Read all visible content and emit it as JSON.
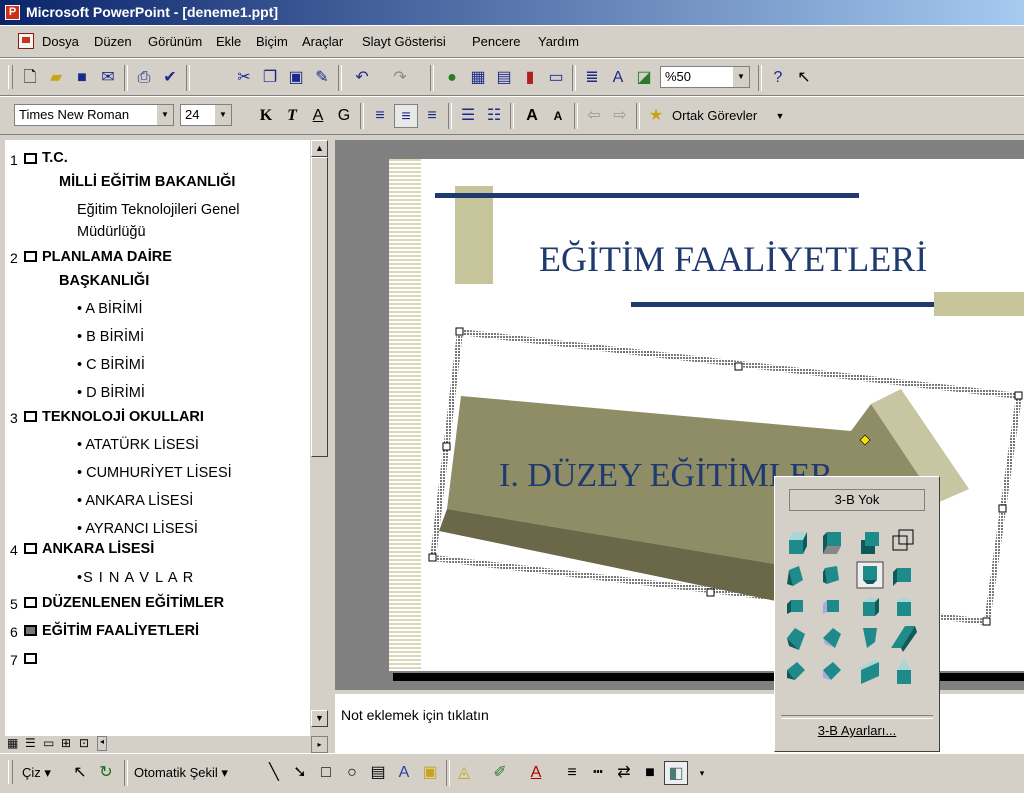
{
  "window": {
    "title": "Microsoft PowerPoint - [deneme1.ppt]"
  },
  "menu": [
    {
      "label": "Dosya"
    },
    {
      "label": "Düzen"
    },
    {
      "label": "Görünüm"
    },
    {
      "label": "Ekle"
    },
    {
      "label": "Biçim"
    },
    {
      "label": "Araçlar"
    },
    {
      "label": "Slayt Gösterisi"
    },
    {
      "label": "Pencere"
    },
    {
      "label": "Yardım"
    }
  ],
  "toolbar": {
    "zoom": "%50"
  },
  "format": {
    "font": "Times New Roman",
    "size": "24",
    "tasks": "Ortak Görevler"
  },
  "outline": {
    "slides": [
      {
        "num": "1",
        "title": "T.C.",
        "title2": "MİLLİ EĞİTİM BAKANLIĞI",
        "sub": "Eğitim Teknolojileri Genel",
        "sub2": "Müdürlüğü",
        "icon": "slide-outline-icon"
      },
      {
        "num": "2",
        "title": "PLANLAMA DAİRE",
        "title2": "BAŞKANLIĞI",
        "bullets": [
          "A BİRİMİ",
          "B BİRİMİ",
          "C BİRİMİ",
          "D BİRİMİ"
        ],
        "icon": "slide-outline-icon"
      },
      {
        "num": "3",
        "title": "TEKNOLOJİ OKULLARI",
        "bullets": [
          "ATATÜRK LİSESİ",
          "CUMHURİYET LİSESİ",
          "ANKARA LİSESİ",
          "AYRANCI LİSESİ"
        ],
        "icon": "slide-outline-icon"
      },
      {
        "num": "4",
        "title": "ANKARA  LİSESİ",
        "bullets": [
          "S I N A V L A R"
        ],
        "icon": "slide-outline-icon"
      },
      {
        "num": "5",
        "title": "DÜZENLENEN EĞİTİMLER",
        "icon": "slide-outline-icon"
      },
      {
        "num": "6",
        "title": "EĞİTİM FAALİYETLERİ",
        "icon": "slide-current-icon"
      },
      {
        "num": "7",
        "title": "",
        "icon": "slide-outline-icon"
      }
    ]
  },
  "slide": {
    "title": "EĞİTİM FAALİYETLERİ",
    "arrow_text": "I. DÜZEY EĞİTİMLER"
  },
  "notes": {
    "placeholder": "Not eklemek için tıklatın"
  },
  "drawing": {
    "draw_label": "Çiz",
    "autoshape_label": "Otomatik Şekil"
  },
  "popup_3d": {
    "none_label": "3-B Yok",
    "settings_label": "3-B Ayarları..."
  },
  "colors": {
    "title_bar_start": "#0a246a",
    "title_bar_end": "#a6caf0",
    "slide_title": "#1f3a6e",
    "accent_olive": "#c5c49a",
    "arrow": "#8f8d66"
  }
}
